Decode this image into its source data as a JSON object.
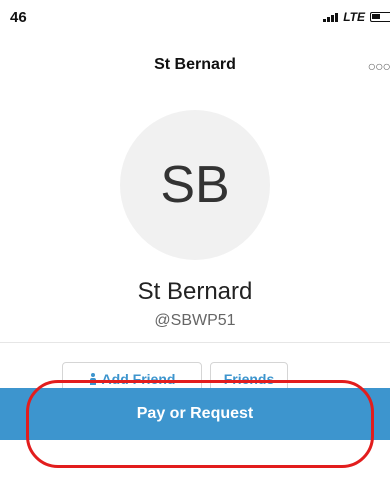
{
  "status_bar": {
    "time": "46",
    "network": "LTE"
  },
  "nav": {
    "title": "St Bernard",
    "more_icon": "more-icon"
  },
  "profile": {
    "initials": "SB",
    "display_name": "St Bernard",
    "username": "@SBWP51"
  },
  "actions": {
    "add_friend_label": "Add Friend",
    "friends_label": "Friends",
    "pay_request_label": "Pay or Request"
  },
  "colors": {
    "accent": "#3d95ce",
    "highlight": "#e21d1d"
  }
}
